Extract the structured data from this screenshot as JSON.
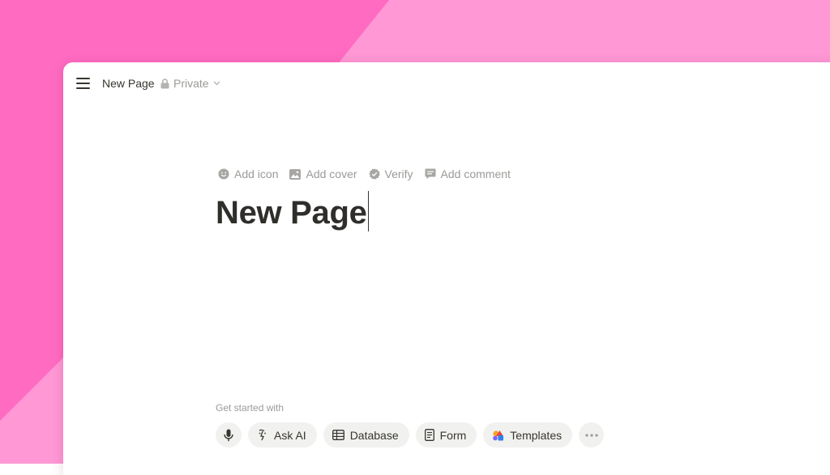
{
  "topbar": {
    "page_title": "New Page",
    "privacy_label": "Private"
  },
  "page_actions": {
    "add_icon": "Add icon",
    "add_cover": "Add cover",
    "verify": "Verify",
    "add_comment": "Add comment"
  },
  "page": {
    "title": "New Page"
  },
  "get_started": {
    "heading": "Get started with",
    "options": {
      "ask_ai": "Ask AI",
      "database": "Database",
      "form": "Form",
      "templates": "Templates"
    }
  },
  "colors": {
    "background_pink": "#ff6bc1",
    "background_light_pink": "#ff98d5",
    "text_primary": "#37352f",
    "text_muted": "#9b9a97",
    "chip_bg": "#f1f1ef"
  },
  "icons": {
    "menu": "hamburger-icon",
    "privacy": "lock-icon",
    "privacy_dropdown": "chevron-down-icon",
    "add_icon": "smiley-icon",
    "add_cover": "image-icon",
    "verify": "verified-badge-icon",
    "add_comment": "comment-icon",
    "voice": "microphone-icon",
    "ask_ai": "ai-face-icon",
    "database": "table-icon",
    "form": "form-icon",
    "templates": "shapes-icon",
    "more": "ellipsis-icon"
  }
}
